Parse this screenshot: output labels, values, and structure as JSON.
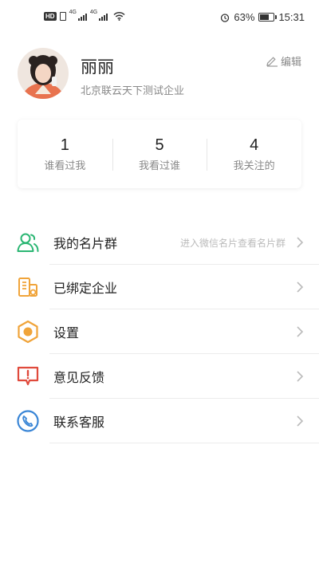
{
  "status_bar": {
    "network_1": "4G",
    "network_2": "4G",
    "battery": "63%",
    "time": "15:31",
    "battery_level": 0.63
  },
  "profile": {
    "name": "丽丽",
    "company": "北京联云天下测试企业",
    "edit_label": "编辑"
  },
  "stats": [
    {
      "value": "1",
      "label": "谁看过我"
    },
    {
      "value": "5",
      "label": "我看过谁"
    },
    {
      "value": "4",
      "label": "我关注的"
    }
  ],
  "menu": [
    {
      "label": "我的名片群",
      "hint": "进入微信名片查看名片群",
      "icon": "contacts-icon"
    },
    {
      "label": "已绑定企业",
      "hint": "",
      "icon": "company-icon"
    },
    {
      "label": "设置",
      "hint": "",
      "icon": "settings-icon"
    },
    {
      "label": "意见反馈",
      "hint": "",
      "icon": "feedback-icon"
    },
    {
      "label": "联系客服",
      "hint": "",
      "icon": "customer-service-icon"
    }
  ],
  "colors": {
    "green": "#2bb673",
    "orange": "#f0a43a",
    "red": "#e04a3c",
    "blue": "#3a86d6"
  }
}
